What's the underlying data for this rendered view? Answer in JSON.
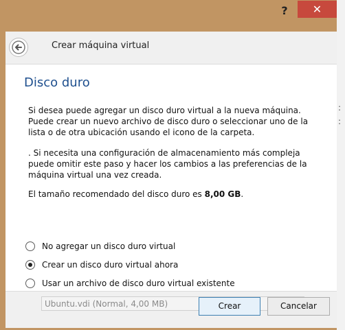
{
  "window": {
    "help_label": "?",
    "close_label": "✕"
  },
  "header": {
    "title": "Crear máquina virtual"
  },
  "page": {
    "title": "Disco duro",
    "para1": "Si desea puede agregar un disco duro virtual a la nueva máquina. Puede crear un nuevo archivo de disco duro o seleccionar uno de la lista o de otra ubicación usando el icono de la carpeta.",
    "para2": ". Si necesita una configuración de almacenamiento más compleja puede omitir este paso y hacer los cambios a las preferencias de la máquina virtual una vez creada.",
    "para3_prefix": "El tamaño recomendado del disco duro es ",
    "para3_size": "8,00 GB",
    "para3_suffix": "."
  },
  "options": [
    {
      "label": "No agregar un disco duro virtual",
      "checked": false
    },
    {
      "label": "Crear un disco duro virtual ahora",
      "checked": true
    },
    {
      "label": "Usar un archivo de disco duro virtual existente",
      "checked": false
    }
  ],
  "disk_select": {
    "value": "Ubuntu.vdi (Normal, 4,00 MB)"
  },
  "buttons": {
    "create": "Crear",
    "cancel": "Cancelar"
  },
  "colors": {
    "frame": "#c19563",
    "close": "#c7493d",
    "title_blue": "#1e4f8e"
  },
  "icons": {
    "back": "back-arrow-icon",
    "folder": "folder-icon"
  }
}
